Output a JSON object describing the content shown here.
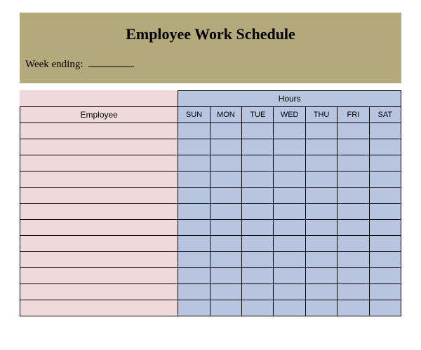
{
  "header": {
    "title": "Employee Work Schedule",
    "week_ending_label": "Week ending:",
    "week_ending_value": ""
  },
  "table": {
    "hours_label": "Hours",
    "employee_label": "Employee",
    "days": [
      "SUN",
      "MON",
      "TUE",
      "WED",
      "THU",
      "FRI",
      "SAT"
    ],
    "rows": [
      {
        "employee": "",
        "hours": [
          "",
          "",
          "",
          "",
          "",
          "",
          ""
        ]
      },
      {
        "employee": "",
        "hours": [
          "",
          "",
          "",
          "",
          "",
          "",
          ""
        ]
      },
      {
        "employee": "",
        "hours": [
          "",
          "",
          "",
          "",
          "",
          "",
          ""
        ]
      },
      {
        "employee": "",
        "hours": [
          "",
          "",
          "",
          "",
          "",
          "",
          ""
        ]
      },
      {
        "employee": "",
        "hours": [
          "",
          "",
          "",
          "",
          "",
          "",
          ""
        ]
      },
      {
        "employee": "",
        "hours": [
          "",
          "",
          "",
          "",
          "",
          "",
          ""
        ]
      },
      {
        "employee": "",
        "hours": [
          "",
          "",
          "",
          "",
          "",
          "",
          ""
        ]
      },
      {
        "employee": "",
        "hours": [
          "",
          "",
          "",
          "",
          "",
          "",
          ""
        ]
      },
      {
        "employee": "",
        "hours": [
          "",
          "",
          "",
          "",
          "",
          "",
          ""
        ]
      },
      {
        "employee": "",
        "hours": [
          "",
          "",
          "",
          "",
          "",
          "",
          ""
        ]
      },
      {
        "employee": "",
        "hours": [
          "",
          "",
          "",
          "",
          "",
          "",
          ""
        ]
      },
      {
        "employee": "",
        "hours": [
          "",
          "",
          "",
          "",
          "",
          "",
          ""
        ]
      }
    ]
  }
}
